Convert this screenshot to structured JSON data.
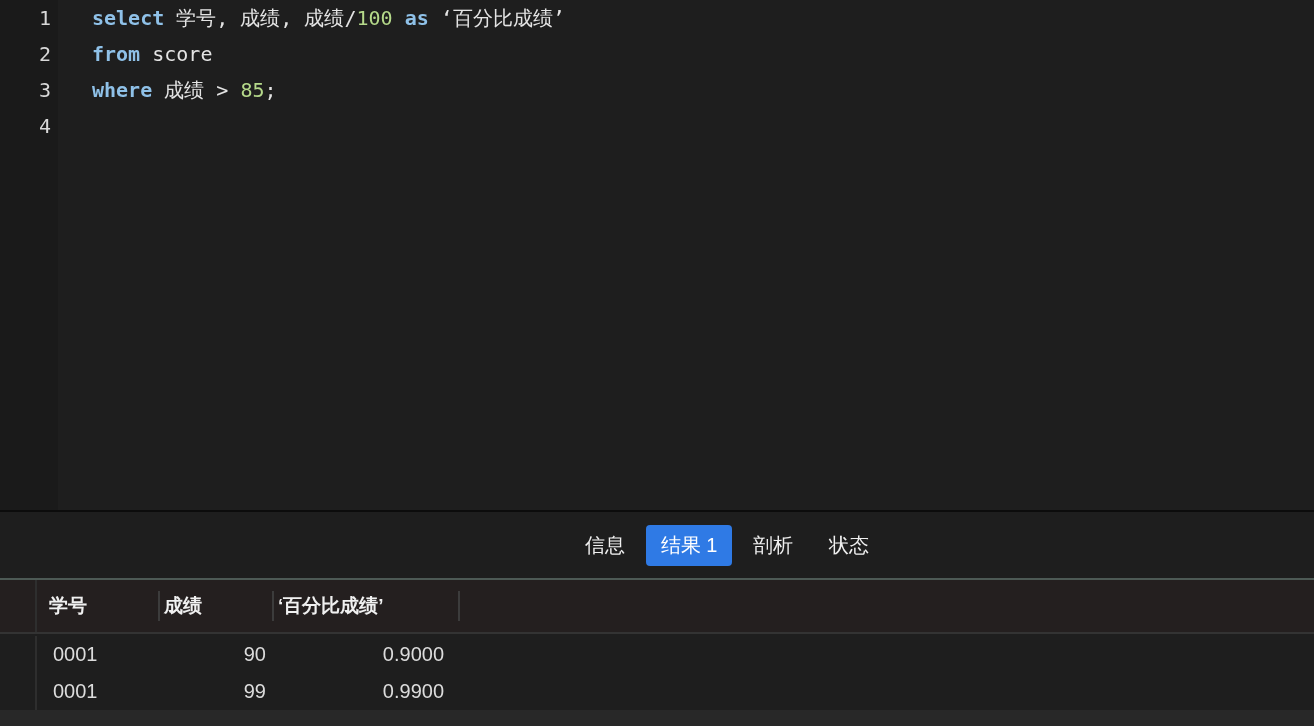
{
  "editor": {
    "lines": [
      {
        "number": "1",
        "tokens": [
          {
            "kind": "keyword",
            "text": "select"
          },
          {
            "kind": "plain",
            "text": " 学号, 成绩, 成绩/"
          },
          {
            "kind": "number",
            "text": "100"
          },
          {
            "kind": "keyword",
            "text": " as"
          },
          {
            "kind": "plain",
            "text": " ‘百分比成绩’"
          }
        ]
      },
      {
        "number": "2",
        "tokens": [
          {
            "kind": "keyword",
            "text": "from"
          },
          {
            "kind": "plain",
            "text": " score"
          }
        ]
      },
      {
        "number": "3",
        "tokens": [
          {
            "kind": "keyword",
            "text": "where"
          },
          {
            "kind": "plain",
            "text": " 成绩 > "
          },
          {
            "kind": "number",
            "text": "85"
          },
          {
            "kind": "plain",
            "text": ";"
          }
        ]
      },
      {
        "number": "4"
      }
    ]
  },
  "result_tabs": [
    {
      "label": "信息",
      "selected": false
    },
    {
      "label": "结果 1",
      "selected": true
    },
    {
      "label": "剖析",
      "selected": false
    },
    {
      "label": "状态",
      "selected": false
    }
  ],
  "table": {
    "columns": [
      {
        "label": "学号"
      },
      {
        "label": "成绩"
      },
      {
        "label": "‘百分比成绩’"
      }
    ],
    "rows": [
      [
        "0001",
        "90",
        "0.9000"
      ],
      [
        "0001",
        "99",
        "0.9900"
      ]
    ]
  }
}
